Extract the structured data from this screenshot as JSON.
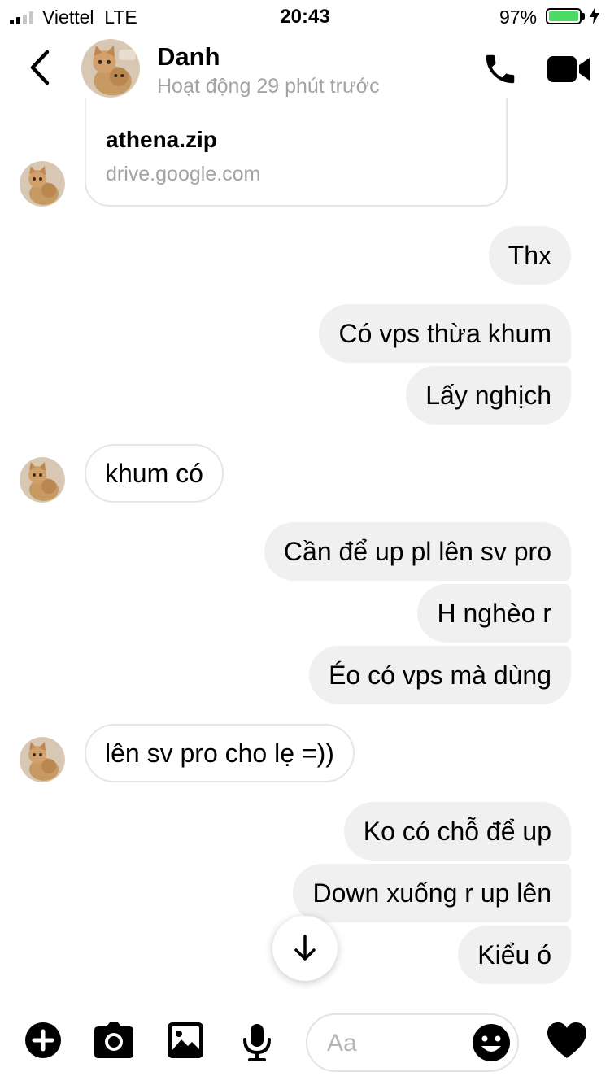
{
  "status_bar": {
    "carrier": "Viettel",
    "network": "LTE",
    "time": "20:43",
    "battery_percent": "97%",
    "battery_level": 0.97,
    "signal_bars": 2
  },
  "header": {
    "contact_name": "Danh",
    "presence": "Hoạt động 29 phút trước",
    "icons": [
      "back-chevron-icon",
      "phone-icon",
      "video-camera-icon"
    ]
  },
  "link_preview": {
    "title": "athena.zip",
    "domain": "drive.google.com"
  },
  "messages": [
    {
      "id": 1,
      "from": "me",
      "text": "Thx"
    },
    {
      "id": 2,
      "from": "me",
      "text": "Có vps thừa khum"
    },
    {
      "id": 3,
      "from": "me",
      "text": "Lấy nghịch"
    },
    {
      "id": 4,
      "from": "Danh",
      "text": "khum có"
    },
    {
      "id": 5,
      "from": "me",
      "text": "Cần để up pl lên sv pro"
    },
    {
      "id": 6,
      "from": "me",
      "text": "H nghèo r"
    },
    {
      "id": 7,
      "from": "me",
      "text": "Éo có vps mà dùng"
    },
    {
      "id": 8,
      "from": "Danh",
      "text": "lên sv pro cho lẹ =))"
    },
    {
      "id": 9,
      "from": "me",
      "text": "Ko có chỗ để up"
    },
    {
      "id": 10,
      "from": "me",
      "text": "Down xuống r up lên"
    },
    {
      "id": 11,
      "from": "me",
      "text": "Kiểu ó"
    }
  ],
  "composer": {
    "placeholder": "Aa",
    "icons": [
      "plus-icon",
      "camera-icon",
      "gallery-icon",
      "microphone-icon",
      "emoji-icon",
      "heart-icon"
    ]
  },
  "colors": {
    "outgoing_bubble": "#f0f0f0",
    "incoming_border": "#e6e6e6",
    "secondary_text": "#a3a3a3",
    "battery_green": "#4cd964",
    "icon": "#000000"
  }
}
